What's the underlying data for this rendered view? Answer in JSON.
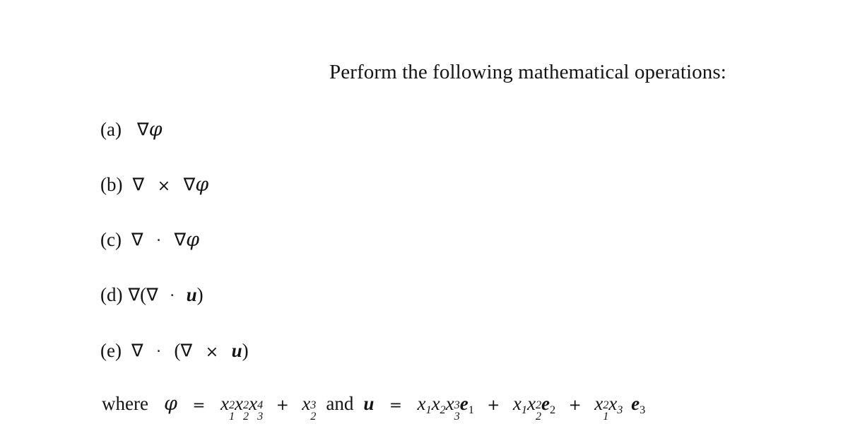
{
  "document": {
    "heading": "Perform the following mathematical operations:",
    "background_color": "#ffffff",
    "text_color": "#141414"
  },
  "items": [
    {
      "label": "(a)",
      "expression": "∇φ",
      "parts": {
        "nabla": "∇",
        "phi": "φ"
      }
    },
    {
      "label": "(b)",
      "expression": "∇ × ∇φ",
      "parts": {
        "nabla": "∇",
        "cross": "×",
        "phi": "φ"
      }
    },
    {
      "label": "(c)",
      "expression": "∇ · ∇φ",
      "parts": {
        "nabla": "∇",
        "dot": "·",
        "phi": "φ"
      }
    },
    {
      "label": "(d)",
      "expression": "∇(∇ · u)",
      "parts": {
        "nabla": "∇",
        "dot": "·",
        "u": "u",
        "lparen": "(",
        "rparen": ")"
      }
    },
    {
      "label": "(e)",
      "expression": "∇ · (∇ × u)",
      "parts": {
        "nabla": "∇",
        "dot": "·",
        "cross": "×",
        "u": "u",
        "lparen": "(",
        "rparen": ")"
      }
    }
  ],
  "definitions": {
    "where_word": "where",
    "and_word": "and",
    "phi_symbol": "φ",
    "u_symbol": "u",
    "equals": "=",
    "plus": "+",
    "x_symbol": "x",
    "e_symbol": "e",
    "phi_expression": "φ = x₁²x₂²x₃⁴ + x₂³",
    "u_expression": "u = x₁x₂x₃³e₁ + x₁x₂²e₂ + x₁²x₃ e₃",
    "phi_terms": [
      {
        "factors": [
          {
            "base": "x",
            "sub": "1",
            "sup": "2"
          },
          {
            "base": "x",
            "sub": "2",
            "sup": "2"
          },
          {
            "base": "x",
            "sub": "3",
            "sup": "4"
          }
        ]
      },
      {
        "factors": [
          {
            "base": "x",
            "sub": "2",
            "sup": "3"
          }
        ]
      }
    ],
    "u_terms": [
      {
        "factors": [
          {
            "base": "x",
            "sub": "1",
            "sup": ""
          },
          {
            "base": "x",
            "sub": "2",
            "sup": ""
          },
          {
            "base": "x",
            "sub": "3",
            "sup": "3"
          }
        ],
        "basis": {
          "base": "e",
          "sub": "1"
        }
      },
      {
        "factors": [
          {
            "base": "x",
            "sub": "1",
            "sup": ""
          },
          {
            "base": "x",
            "sub": "2",
            "sup": "2"
          }
        ],
        "basis": {
          "base": "e",
          "sub": "2"
        }
      },
      {
        "factors": [
          {
            "base": "x",
            "sub": "1",
            "sup": "2"
          },
          {
            "base": "x",
            "sub": "3",
            "sup": ""
          }
        ],
        "basis": {
          "base": "e",
          "sub": "3"
        }
      }
    ]
  }
}
